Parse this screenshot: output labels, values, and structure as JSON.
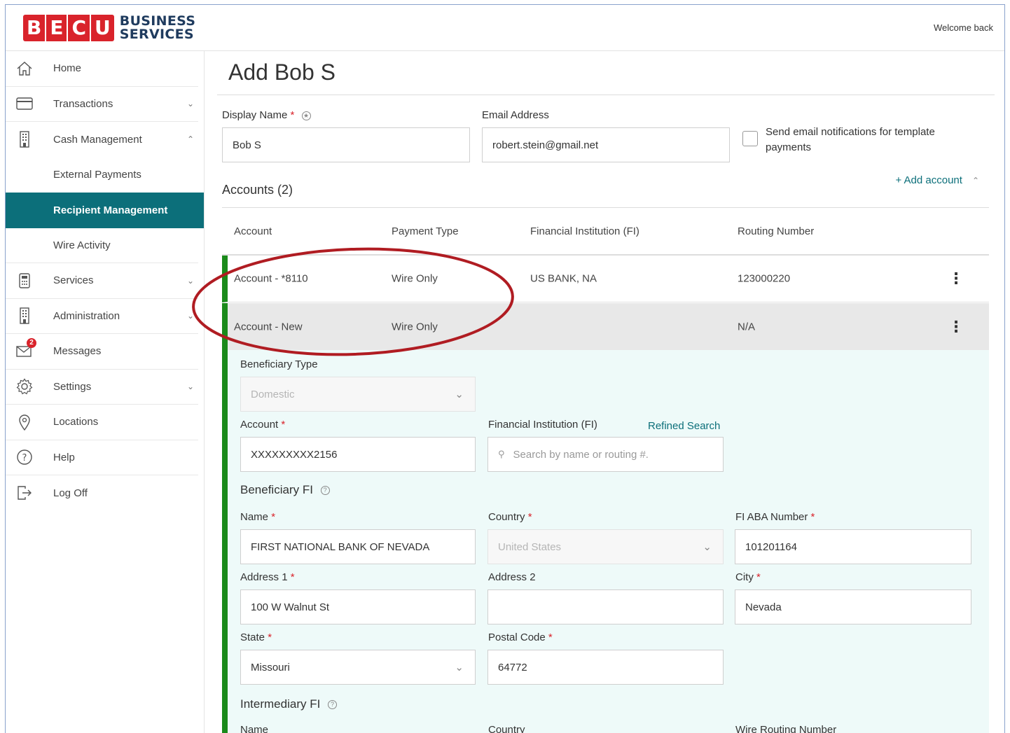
{
  "header": {
    "logo_letters": [
      "B",
      "E",
      "C",
      "U"
    ],
    "logo_line1": "BUSINESS",
    "logo_line2": "SERVICES",
    "welcome": "Welcome back"
  },
  "sidebar": {
    "home": "Home",
    "transactions": "Transactions",
    "cash_management": "Cash Management",
    "external_payments": "External Payments",
    "recipient_management": "Recipient Management",
    "wire_activity": "Wire Activity",
    "services": "Services",
    "administration": "Administration",
    "messages": "Messages",
    "messages_badge": "2",
    "settings": "Settings",
    "locations": "Locations",
    "help": "Help",
    "log_off": "Log Off"
  },
  "page": {
    "title": "Add Bob S"
  },
  "form": {
    "display_name_label": "Display Name",
    "display_name_value": "Bob S",
    "email_label": "Email Address",
    "email_value": "robert.stein@gmail.net",
    "notify_label_1": "Send email notifications for template",
    "notify_label_2": "payments"
  },
  "accounts": {
    "title": "Accounts (2)",
    "add_account": "+ Add account",
    "columns": [
      "Account",
      "Payment Type",
      "Financial Institution (FI)",
      "Routing Number"
    ],
    "rows": [
      {
        "account": "Account - *8110",
        "payment_type": "Wire Only",
        "fi": "US BANK, NA",
        "routing": "123000220"
      },
      {
        "account": "Account - New",
        "payment_type": "Wire Only",
        "fi": "",
        "routing": "N/A"
      }
    ]
  },
  "detail": {
    "beneficiary_type_label": "Beneficiary Type",
    "beneficiary_type_value": "Domestic",
    "account_label": "Account",
    "account_value": "XXXXXXXXX2156",
    "fi_label": "Financial Institution (FI)",
    "refined_search": "Refined Search",
    "fi_search_placeholder": "Search by name or routing #.",
    "beneficiary_fi_title": "Beneficiary FI",
    "name_label": "Name",
    "name_value": "FIRST NATIONAL BANK OF NEVADA",
    "country_label": "Country",
    "country_value": "United States",
    "aba_label": "FI ABA Number",
    "aba_value": "101201164",
    "address1_label": "Address 1",
    "address1_value": "100 W Walnut St",
    "address2_label": "Address 2",
    "address2_value": "",
    "city_label": "City",
    "city_value": "Nevada",
    "state_label": "State",
    "state_value": "Missouri",
    "postal_label": "Postal Code",
    "postal_value": "64772",
    "intermediary_fi_title": "Intermediary FI",
    "int_name_label": "Name",
    "int_country_label": "Country",
    "int_routing_label": "Wire Routing Number"
  },
  "colors": {
    "brand_red": "#d9232b",
    "teal": "#0c6f7a",
    "green_bar": "#1a8a1a",
    "annotation_oval": "#b01c22"
  }
}
